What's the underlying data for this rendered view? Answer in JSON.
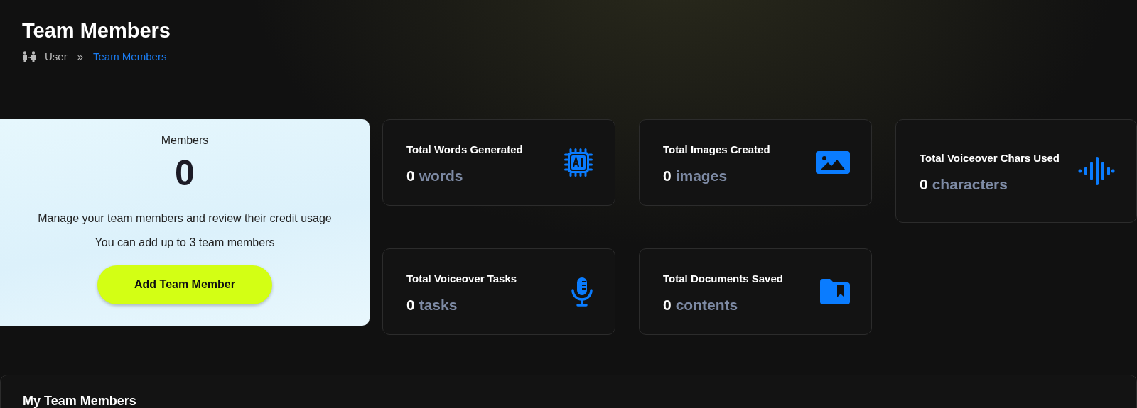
{
  "header": {
    "title": "Team Members",
    "breadcrumb": [
      {
        "label": "User",
        "selected": false
      },
      {
        "label": "Team Members",
        "selected": true
      }
    ],
    "separator": "»"
  },
  "members_card": {
    "label": "Members",
    "count": "0",
    "description": "Manage your team members and review their credit usage",
    "limit_note": "You can add up to 3 team members",
    "button": "Add Team Member"
  },
  "stats": [
    {
      "title": "Total Words Generated",
      "value": "0",
      "unit": "words",
      "kind": "ai-chip"
    },
    {
      "title": "Total Images Created",
      "value": "0",
      "unit": "images",
      "kind": "image"
    },
    {
      "title": "Total Voiceover Chars Used",
      "value": "0",
      "unit": "characters",
      "kind": "waveform"
    },
    {
      "title": "Total Voiceover Tasks",
      "value": "0",
      "unit": "tasks",
      "kind": "microphone"
    },
    {
      "title": "Total Documents Saved",
      "value": "0",
      "unit": "contents",
      "kind": "folder"
    }
  ],
  "team_panel": {
    "title": "My Team Members"
  }
}
